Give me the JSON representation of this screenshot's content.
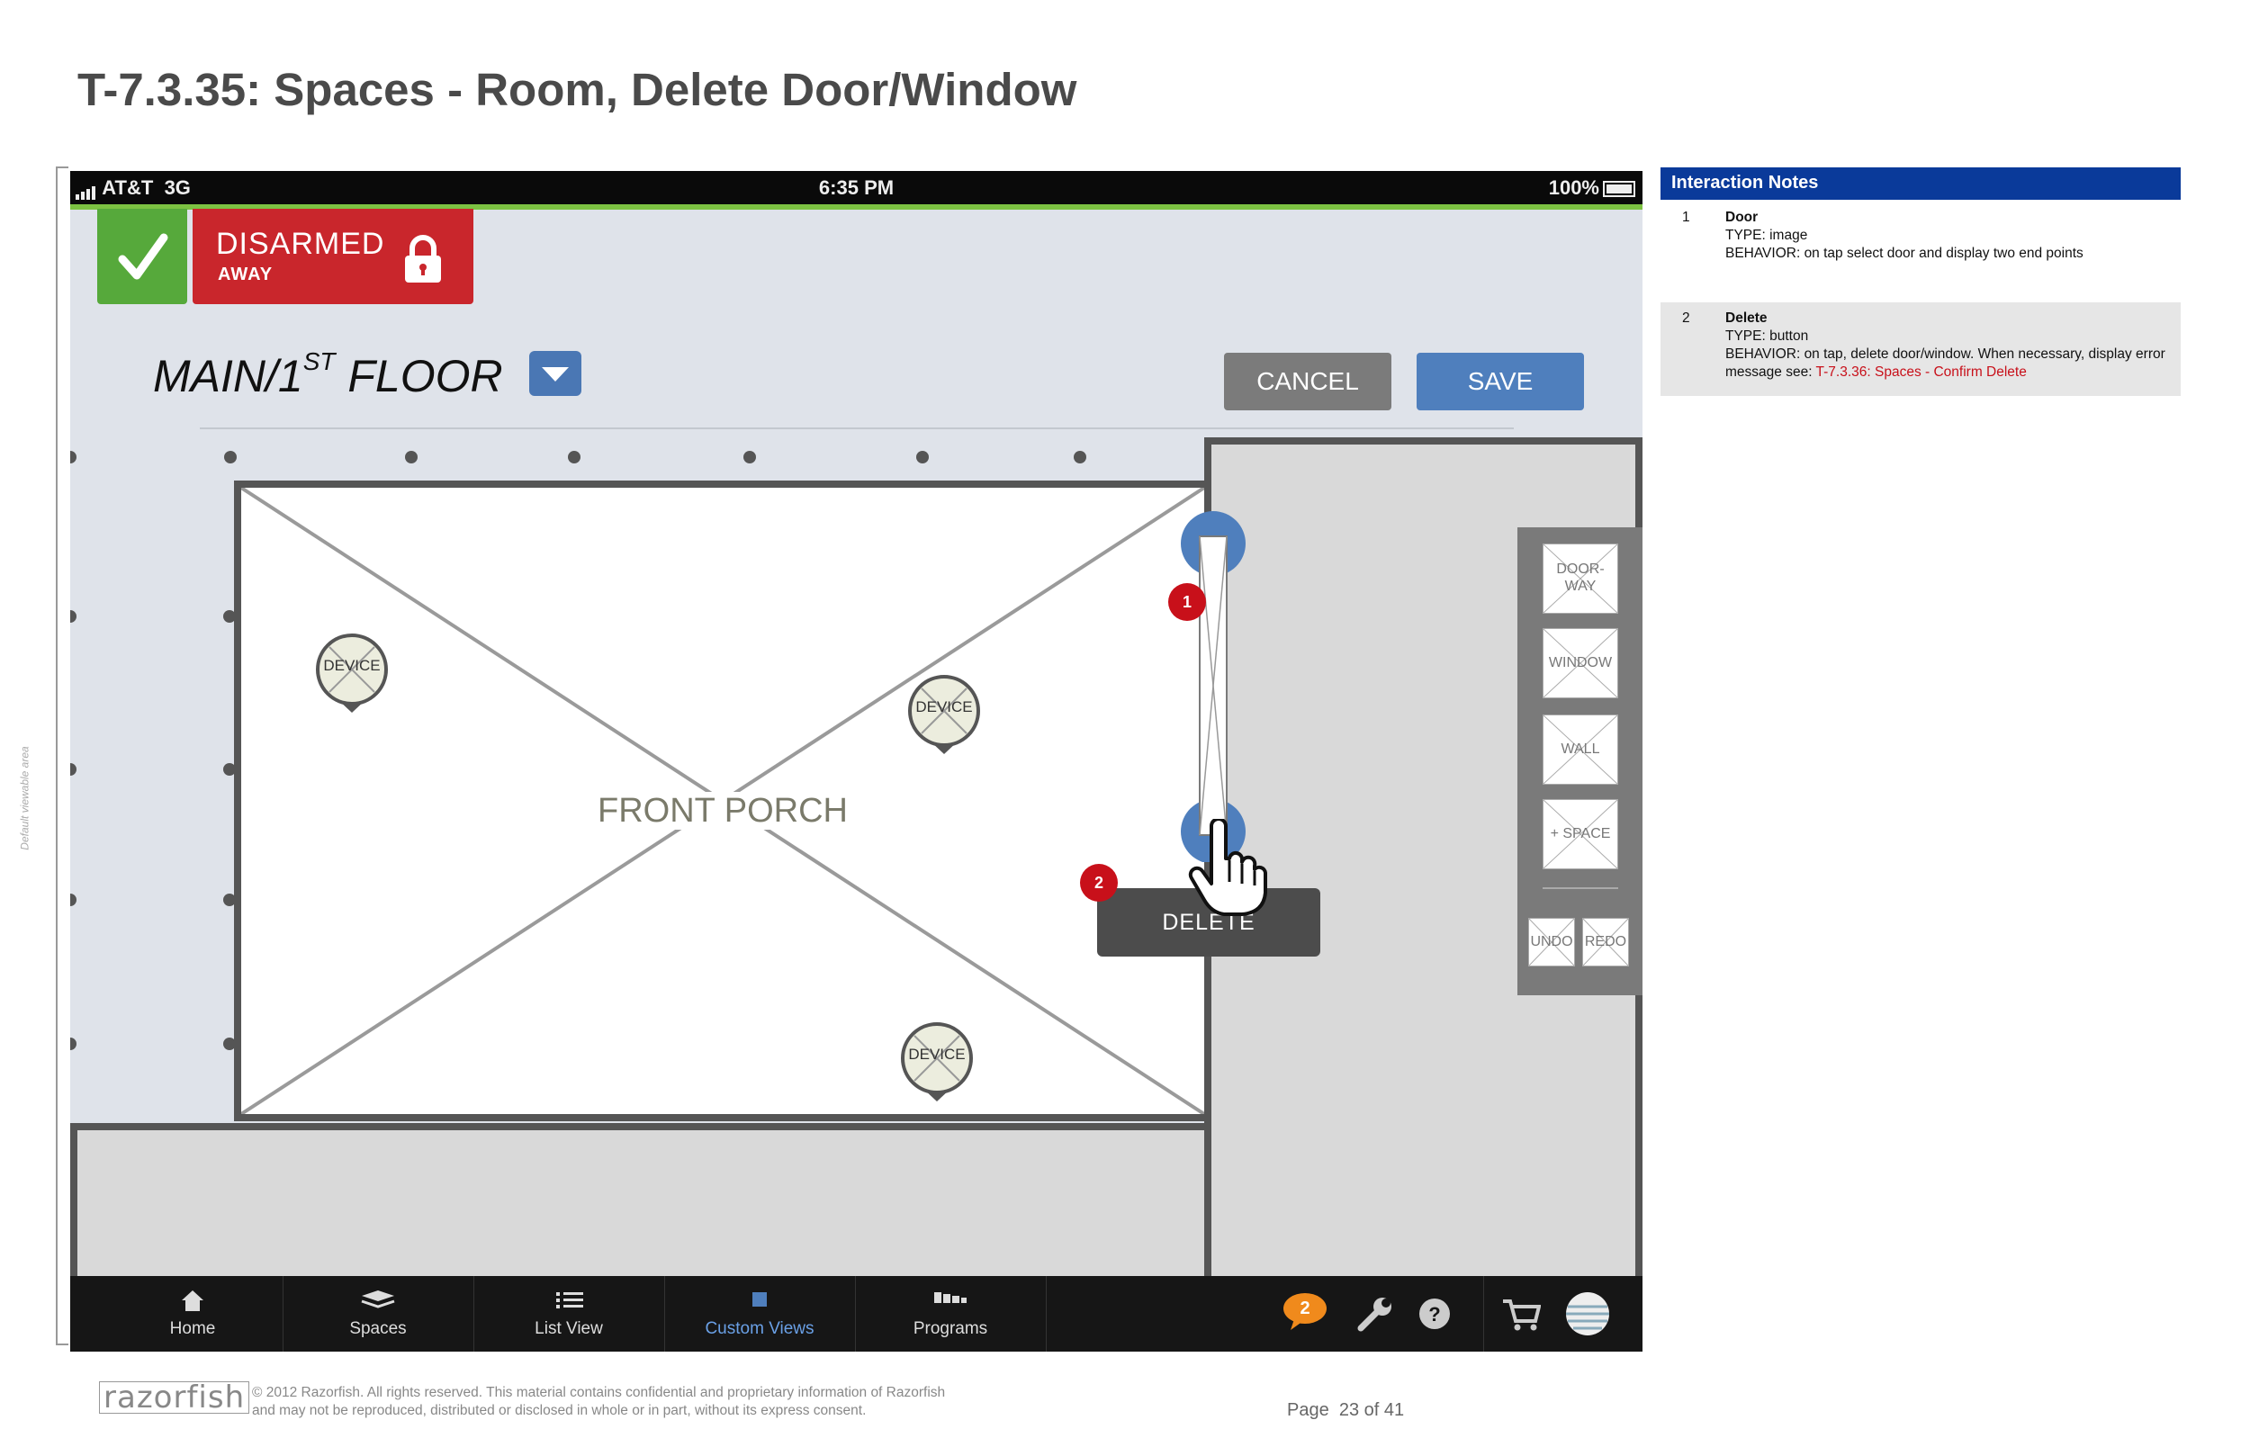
{
  "page": {
    "title": "T-7.3.35: Spaces - Room, Delete Door/Window",
    "viewable_label": "Default viewable area"
  },
  "status_bar": {
    "carrier": "AT&T",
    "network": "3G",
    "time": "6:35 PM",
    "battery": "100%"
  },
  "security": {
    "status": "DISARMED",
    "mode": "AWAY"
  },
  "floor": {
    "name": "MAIN/1",
    "ordinal": "ST",
    "suffix": " FLOOR"
  },
  "actions": {
    "cancel": "CANCEL",
    "save": "SAVE"
  },
  "room": {
    "label": "FRONT PORCH"
  },
  "devices": [
    "DEVICE",
    "DEVICE",
    "DEVICE"
  ],
  "callouts": {
    "door": "1",
    "delete": "2"
  },
  "delete_button": "DELETE",
  "tools": {
    "doorway_1": "DOOR-",
    "doorway_2": "WAY",
    "window": "WINDOW",
    "wall": "WALL",
    "space": "+ SPACE",
    "undo": "UNDO",
    "redo": "REDO"
  },
  "tab_bar": {
    "tabs": [
      "Home",
      "Spaces",
      "List View",
      "Custom Views",
      "Programs"
    ],
    "active": "Custom Views",
    "message_count": "2",
    "help": "?"
  },
  "colors": {
    "accent_blue": "#4f7fbd",
    "disarmed_red": "#c9262c",
    "armed_green": "#56a93b",
    "notes_header": "#0a3a9a",
    "callout_red": "#c8101a"
  },
  "notes": {
    "header": "Interaction Notes",
    "items": [
      {
        "num": "1",
        "title": "Door",
        "type": "TYPE: image",
        "behavior": "BEHAVIOR: on tap select door and display two end points"
      },
      {
        "num": "2",
        "title": "Delete",
        "type": "TYPE: button",
        "behavior": "BEHAVIOR: on tap, delete door/window. When necessary, display error message see: ",
        "link": "T-7.3.36: Spaces - Confirm Delete"
      }
    ]
  },
  "footer": {
    "logo": "razorfish",
    "copyright_1": "© 2012 Razorfish. All rights reserved. This material contains confidential and proprietary information of Razorfish",
    "copyright_2": "and may not be reproduced, distributed or disclosed in whole or in part, without its express consent.",
    "page_label": "Page",
    "page_number": "23 of 41"
  }
}
